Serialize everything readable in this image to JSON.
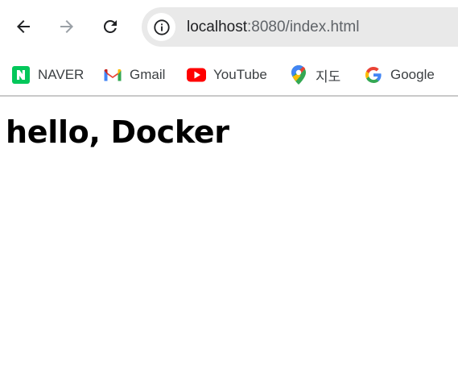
{
  "toolbar": {
    "back_icon": "arrow-left-icon",
    "forward_icon": "arrow-right-icon",
    "reload_icon": "reload-icon",
    "address": {
      "info_icon": "info-icon",
      "host": "localhost",
      "rest": ":8080/index.html"
    }
  },
  "bookmarks": [
    {
      "label": "NAVER",
      "icon": "naver-icon",
      "color": "#03c75a"
    },
    {
      "label": "Gmail",
      "icon": "gmail-icon",
      "color": "#ea4335"
    },
    {
      "label": "YouTube",
      "icon": "youtube-icon",
      "color": "#ff0000"
    },
    {
      "label": "지도",
      "icon": "maps-pin-icon",
      "color": "#34a853"
    },
    {
      "label": "Google",
      "icon": "google-icon",
      "color": "#4285f4"
    }
  ],
  "page": {
    "heading": "hello, Docker"
  }
}
